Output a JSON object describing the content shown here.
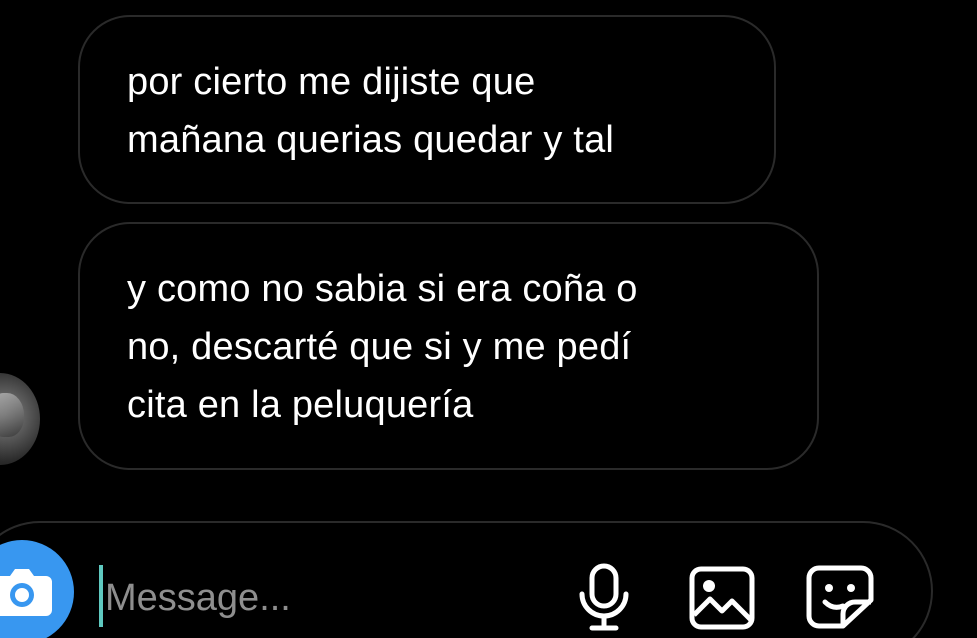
{
  "messages": [
    {
      "lines": [
        "por cierto me dijiste que",
        "mañana querias quedar y tal"
      ]
    },
    {
      "lines": [
        "y como no sabia si era coña o",
        "no, descarté que si y me pedí",
        "cita en la peluquería"
      ]
    }
  ],
  "composer": {
    "placeholder": "Message...",
    "value": ""
  },
  "icons": {
    "camera": "camera-icon",
    "mic": "microphone-icon",
    "gallery": "gallery-icon",
    "sticker": "sticker-icon"
  },
  "colors": {
    "background": "#000000",
    "bubble_border": "#2a2a2a",
    "text": "#ffffff",
    "placeholder": "#8e8e8e",
    "camera_accent": "#3897f0",
    "caret": "#5fc9c0"
  }
}
